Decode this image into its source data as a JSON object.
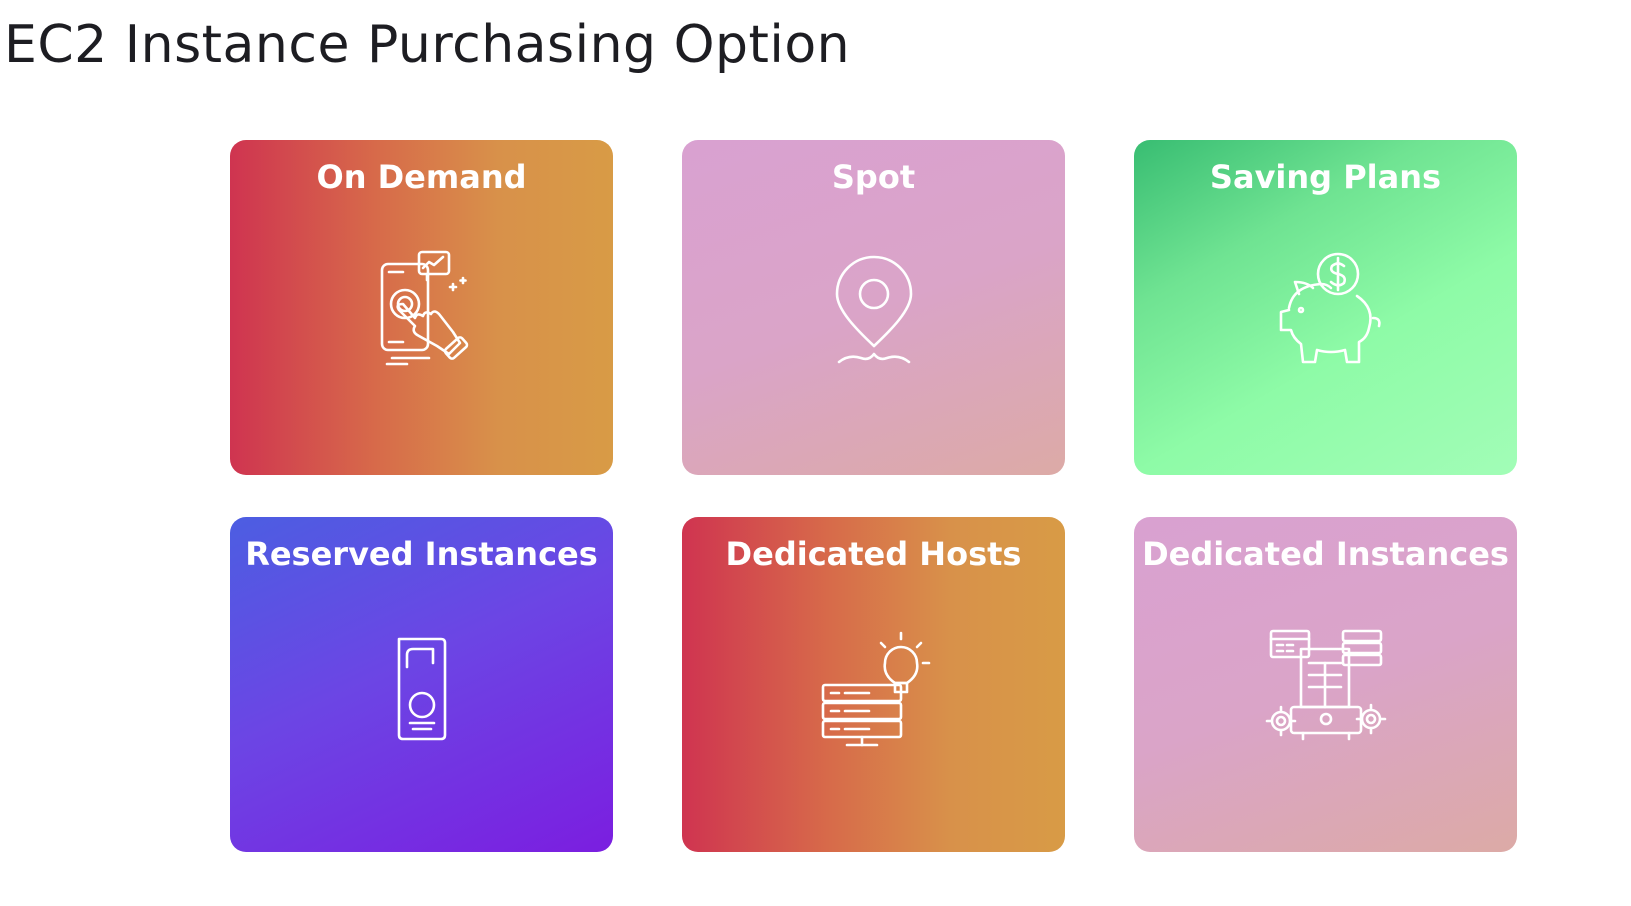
{
  "page": {
    "title": "EC2 Instance Purchasing Option"
  },
  "cards": [
    {
      "title": "On Demand",
      "icon": "touch-screen-hand-icon",
      "gradient": [
        "#cf3450",
        "#d89b46"
      ]
    },
    {
      "title": "Spot",
      "icon": "location-pin-icon",
      "gradient": [
        "#d9a1d1",
        "#dcaaa6"
      ]
    },
    {
      "title": "Saving Plans",
      "icon": "piggy-bank-dollar-icon",
      "gradient": [
        "#38bd72",
        "#a2fdb7"
      ]
    },
    {
      "title": "Reserved Instances",
      "icon": "door-hanger-icon",
      "gradient": [
        "#4c5ee2",
        "#7b1ee0"
      ]
    },
    {
      "title": "Dedicated Hosts",
      "icon": "server-lightbulb-icon",
      "gradient": [
        "#cf3450",
        "#d89b46"
      ]
    },
    {
      "title": "Dedicated Instances",
      "icon": "server-gears-icon",
      "gradient": [
        "#d9a1d1",
        "#dcaaa6"
      ]
    }
  ]
}
